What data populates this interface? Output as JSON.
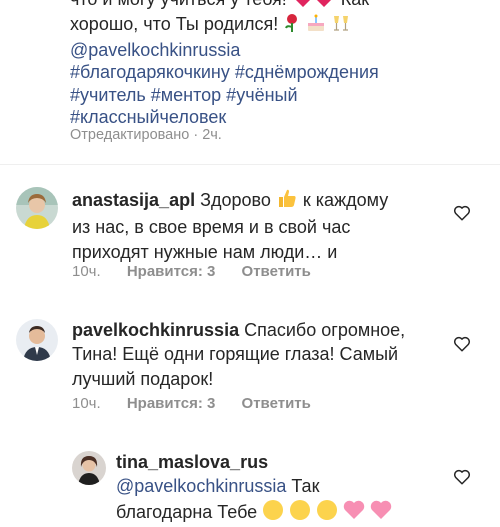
{
  "caption": {
    "line0": "что и могу учиться у тебя!",
    "line0_tail": "Как",
    "line1": "хорошо, что Ты родился!",
    "mention": "@pavelkochkinrussia",
    "tags_line1": "#благодарякочкину #сднёмрождения",
    "tags_line2": "#учитель #ментор #учёный",
    "tags_line3": "#классныйчеловек",
    "edited": "Отредактировано · 2ч."
  },
  "comments": [
    {
      "username": "anastasija_apl",
      "line1_text": "Здорово",
      "line1_tail": "к каждому",
      "line2": "из нас, в свое время и в свой час",
      "line3": "приходят нужные нам люди… и",
      "time": "10ч.",
      "likes": "Нравится: 3",
      "reply": "Ответить"
    },
    {
      "username": "pavelkochkinrussia",
      "line1_text": "Спасибо огромное,",
      "line2": "Тина! Ещё одни горящие глаза! Самый",
      "line3": "лучший подарок!",
      "time": "10ч.",
      "likes": "Нравится: 3",
      "reply": "Ответить"
    },
    {
      "username": "tina_maslova_rus",
      "mention": "@pavelkochkinrussia",
      "line1_tail": "Так",
      "line2": "благодарна Тебе",
      "time": "",
      "likes": "",
      "reply": ""
    }
  ],
  "icons": {
    "heart": "heart-outline-icon",
    "rose": "rose-emoji",
    "cake": "birthday-cake-emoji",
    "champagne": "clinking-glasses-emoji",
    "thumbs": "thumbs-up-emoji",
    "smile": "smiling-face-emoji",
    "hearts": "two-hearts-emoji"
  },
  "colors": {
    "link": "#385185",
    "muted": "#8e8e8e",
    "text": "#262626",
    "divider": "#efefef"
  }
}
